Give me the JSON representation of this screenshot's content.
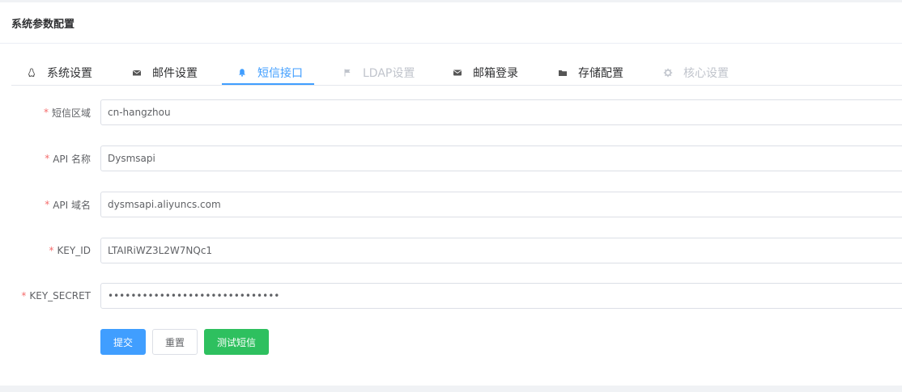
{
  "card": {
    "title": "系统参数配置"
  },
  "tabs": [
    {
      "label": "系统设置",
      "icon": "linux-icon",
      "state": "normal"
    },
    {
      "label": "邮件设置",
      "icon": "envelope-icon",
      "state": "normal"
    },
    {
      "label": "短信接口",
      "icon": "bell-icon",
      "state": "active"
    },
    {
      "label": "LDAP设置",
      "icon": "flag-icon",
      "state": "disabled"
    },
    {
      "label": "邮箱登录",
      "icon": "mail-icon",
      "state": "normal"
    },
    {
      "label": "存储配置",
      "icon": "folder-icon",
      "state": "normal"
    },
    {
      "label": "核心设置",
      "icon": "gear-icon",
      "state": "disabled"
    }
  ],
  "form": {
    "required_mark": "*",
    "fields": [
      {
        "label": "短信区域",
        "value": "cn-hangzhou"
      },
      {
        "label": "API 名称",
        "value": "Dysmsapi"
      },
      {
        "label": "API 域名",
        "value": "dysmsapi.aliyuncs.com"
      },
      {
        "label": "KEY_ID",
        "value": "LTAIRiWZ3L2W7NQc1"
      },
      {
        "label": "KEY_SECRET",
        "value": "••••••••••••••••••••••••••••••"
      }
    ]
  },
  "buttons": {
    "submit": "提交",
    "reset": "重置",
    "test": "测试短信"
  },
  "colors": {
    "accent": "#409eff",
    "success": "#2ec05f",
    "required": "#f56c6c",
    "disabled": "#c0c4cc"
  }
}
